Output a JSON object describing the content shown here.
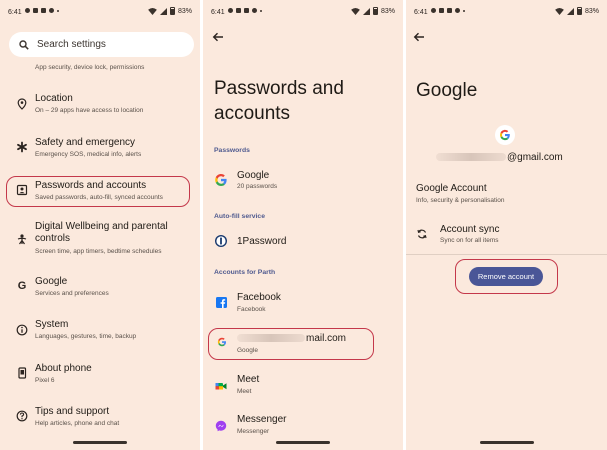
{
  "status": {
    "time": "6:41",
    "battery": "83%"
  },
  "screen1": {
    "search_label": "Search settings",
    "top_subtitle": "App security, device lock, permissions",
    "items": [
      {
        "title": "Location",
        "subtitle": "On – 29 apps have access to location",
        "icon": "location-pin-icon"
      },
      {
        "title": "Safety and emergency",
        "subtitle": "Emergency SOS, medical info, alerts",
        "icon": "asterisk-icon"
      },
      {
        "title": "Passwords and accounts",
        "subtitle": "Saved passwords, auto-fill, synced accounts",
        "icon": "account-box-icon"
      },
      {
        "title": "Digital Wellbeing and parental controls",
        "subtitle": "Screen time, app timers, bedtime schedules",
        "icon": "wellbeing-icon"
      },
      {
        "title": "Google",
        "subtitle": "Services and preferences",
        "icon": "google-g-icon"
      },
      {
        "title": "System",
        "subtitle": "Languages, gestures, time, backup",
        "icon": "info-icon"
      },
      {
        "title": "About phone",
        "subtitle": "Pixel 6",
        "icon": "phone-icon"
      },
      {
        "title": "Tips and support",
        "subtitle": "Help articles, phone and chat",
        "icon": "help-icon"
      }
    ]
  },
  "screen2": {
    "title_line1": "Passwords and",
    "title_line2": "accounts",
    "sections": {
      "passwords": "Passwords",
      "autofill": "Auto-fill service",
      "accounts": "Accounts for Parth"
    },
    "google_pw": {
      "title": "Google",
      "subtitle": "20 passwords"
    },
    "onepassword": {
      "title": "1Password"
    },
    "accounts": [
      {
        "title": "Facebook",
        "subtitle": "Facebook"
      },
      {
        "title": "mail.com",
        "subtitle": "Google"
      },
      {
        "title": "Meet",
        "subtitle": "Meet"
      },
      {
        "title": "Messenger",
        "subtitle": "Messenger"
      }
    ]
  },
  "screen3": {
    "title": "Google",
    "email_suffix": "@gmail.com",
    "google_account": {
      "title": "Google Account",
      "subtitle": "Info, security & personalisation"
    },
    "account_sync": {
      "title": "Account sync",
      "subtitle": "Sync on for all items"
    },
    "remove_button": "Remove account"
  },
  "colors": {
    "background": "#fbe9dd",
    "accent": "#4f5a8f",
    "button": "#4a5697",
    "highlight": "#c4384a"
  }
}
